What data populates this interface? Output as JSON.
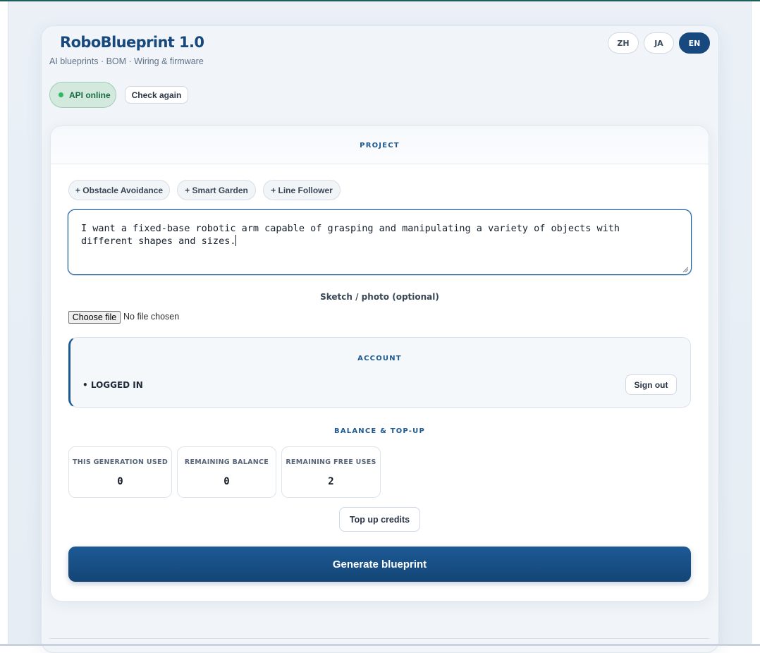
{
  "app": {
    "title": "RoboBlueprint 1.0",
    "subtitle": "AI blueprints · BOM · Wiring & firmware"
  },
  "languages": [
    {
      "label": "ZH",
      "active": false
    },
    {
      "label": "JA",
      "active": false
    },
    {
      "label": "EN",
      "active": true
    }
  ],
  "status": {
    "label": "API online",
    "color": "#2cb866",
    "check_again_label": "Check again"
  },
  "project": {
    "section_title": "PROJECT",
    "templates": [
      "+ Obstacle Avoidance",
      "+ Smart Garden",
      "+ Line Follower"
    ],
    "prompt_value": "I want a fixed-base robotic arm capable of grasping and manipulating a variety of objects with\ndifferent shapes and sizes.",
    "upload_label": "Sketch / photo (optional)",
    "choose_file_label": "Choose file",
    "file_status": "No file chosen"
  },
  "account": {
    "section_title": "ACCOUNT",
    "status_text": "• LOGGED IN",
    "sign_out_label": "Sign out"
  },
  "balance": {
    "section_title": "BALANCE & TOP-UP",
    "stats": [
      {
        "label": "THIS GENERATION USED",
        "value": "0"
      },
      {
        "label": "REMAINING BALANCE",
        "value": "0"
      },
      {
        "label": "REMAINING FREE USES",
        "value": "2"
      }
    ],
    "top_up_label": "Top up credits"
  },
  "actions": {
    "generate_label": "Generate blueprint"
  },
  "colors": {
    "brand": "#17497e",
    "accent": "#1d5a91",
    "online": "#2cb866"
  }
}
